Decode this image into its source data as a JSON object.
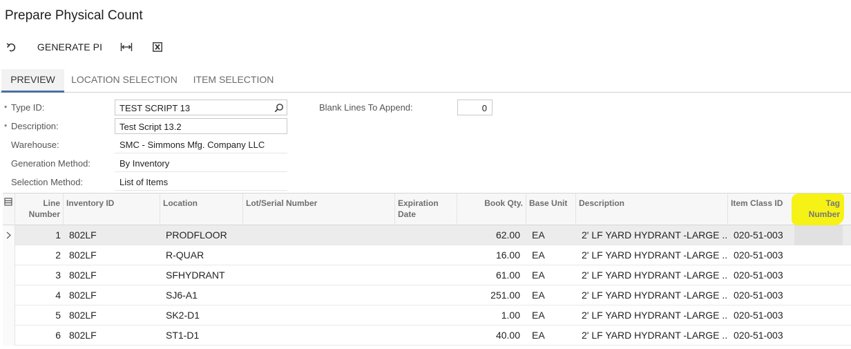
{
  "page": {
    "title": "Prepare Physical Count"
  },
  "toolbar": {
    "undo_icon": "undo-icon",
    "generate_label": "GENERATE PI",
    "fit_icon": "fit-columns-icon",
    "excel_icon": "excel-export-icon"
  },
  "tabs": [
    {
      "label": "PREVIEW",
      "active": true
    },
    {
      "label": "LOCATION SELECTION",
      "active": false
    },
    {
      "label": "ITEM SELECTION",
      "active": false
    }
  ],
  "form": {
    "type_id": {
      "label": "Type ID:",
      "value": "TEST SCRIPT 13",
      "required": "*"
    },
    "description": {
      "label": "Description:",
      "value": "Test Script 13.2",
      "required": "*"
    },
    "warehouse": {
      "label": "Warehouse:",
      "value": "SMC - Simmons Mfg. Company LLC"
    },
    "generation_method": {
      "label": "Generation Method:",
      "value": "By Inventory"
    },
    "selection_method": {
      "label": "Selection Method:",
      "value": "List of Items"
    },
    "blank_lines": {
      "label": "Blank Lines To Append:",
      "value": "0"
    }
  },
  "grid": {
    "columns": {
      "line_number": "Line Number",
      "inventory_id": "Inventory ID",
      "location": "Location",
      "lot_serial": "Lot/Serial Number",
      "expiration": "Expiration Date",
      "book_qty": "Book Qty.",
      "base_unit": "Base Unit",
      "description": "Description",
      "item_class": "Item Class ID",
      "tag_number": "Tag Number"
    },
    "rows": [
      {
        "line": "1",
        "inventory_id": "802LF",
        "location": "PRODFLOOR",
        "lot": "",
        "exp": "",
        "qty": "62.00",
        "unit": "EA",
        "desc": "2' LF YARD HYDRANT -LARGE ...",
        "class": "020-51-003",
        "tag": ""
      },
      {
        "line": "2",
        "inventory_id": "802LF",
        "location": "R-QUAR",
        "lot": "",
        "exp": "",
        "qty": "16.00",
        "unit": "EA",
        "desc": "2' LF YARD HYDRANT -LARGE ...",
        "class": "020-51-003",
        "tag": ""
      },
      {
        "line": "3",
        "inventory_id": "802LF",
        "location": "SFHYDRANT",
        "lot": "",
        "exp": "",
        "qty": "61.00",
        "unit": "EA",
        "desc": "2' LF YARD HYDRANT -LARGE ...",
        "class": "020-51-003",
        "tag": ""
      },
      {
        "line": "4",
        "inventory_id": "802LF",
        "location": "SJ6-A1",
        "lot": "",
        "exp": "",
        "qty": "251.00",
        "unit": "EA",
        "desc": "2' LF YARD HYDRANT -LARGE ...",
        "class": "020-51-003",
        "tag": ""
      },
      {
        "line": "5",
        "inventory_id": "802LF",
        "location": "SK2-D1",
        "lot": "",
        "exp": "",
        "qty": "1.00",
        "unit": "EA",
        "desc": "2' LF YARD HYDRANT -LARGE ...",
        "class": "020-51-003",
        "tag": ""
      },
      {
        "line": "6",
        "inventory_id": "802LF",
        "location": "ST1-D1",
        "lot": "",
        "exp": "",
        "qty": "40.00",
        "unit": "EA",
        "desc": "2' LF YARD HYDRANT -LARGE ...",
        "class": "020-51-003",
        "tag": ""
      }
    ]
  },
  "colors": {
    "accent": "#4a6fa5",
    "highlight": "#f5f10a"
  }
}
